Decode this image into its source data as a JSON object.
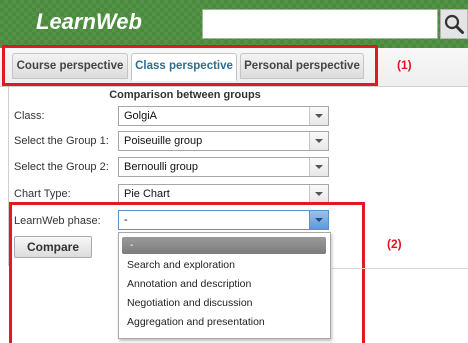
{
  "app": {
    "title": "LearnWeb"
  },
  "search": {
    "placeholder": ""
  },
  "tabs": [
    {
      "label": "Course perspective",
      "active": false
    },
    {
      "label": "Class perspective",
      "active": true
    },
    {
      "label": "Personal perspective",
      "active": false
    }
  ],
  "annotations": {
    "marker1": "(1)",
    "marker2": "(2)",
    "highlight_color": "#e01a22"
  },
  "form": {
    "title": "Comparison between groups",
    "fields": [
      {
        "label": "Class:",
        "value": "GolgiA"
      },
      {
        "label": "Select the Group 1:",
        "value": "Poiseuille group"
      },
      {
        "label": "Select the Group 2:",
        "value": "Bernoulli group"
      },
      {
        "label": "Chart Type:",
        "value": "Pie Chart"
      },
      {
        "label": "LearnWeb phase:",
        "value": "-"
      }
    ],
    "compare_label": "Compare"
  },
  "dropdown": {
    "options": [
      "-",
      "Search and exploration",
      "Annotation and description",
      "Negotiation and discussion",
      "Aggregation and presentation"
    ],
    "selected_index": 0
  },
  "colors": {
    "header": "#4a8a3c",
    "active_tab_text": "#2d6e8e"
  },
  "icons": {
    "search": "magnifier-icon"
  }
}
